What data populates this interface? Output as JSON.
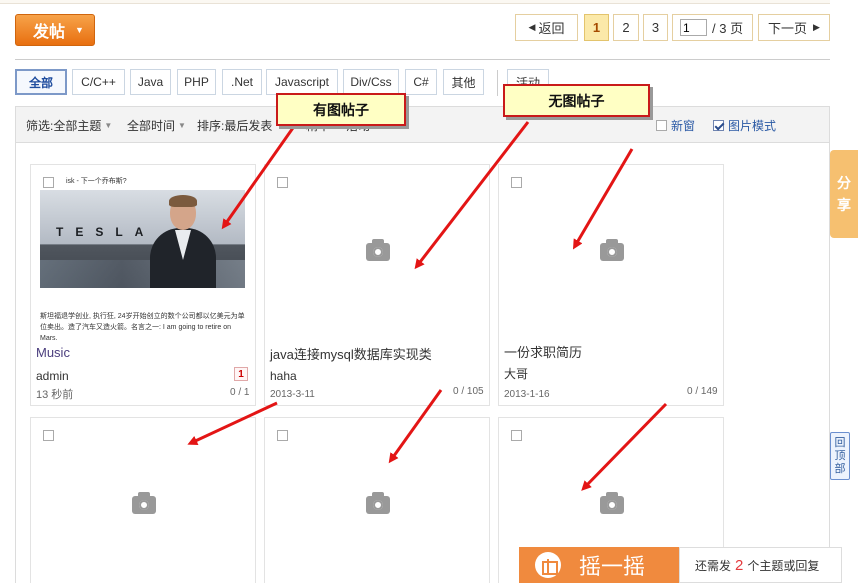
{
  "toolbar": {
    "post_label": "发帖",
    "post_caret": "▼"
  },
  "pager": {
    "back_label": "返回",
    "back_arrow": "◀",
    "pages": [
      "1",
      "2",
      "3"
    ],
    "current": "1",
    "input_value": "1",
    "total_label": "/ 3 页",
    "next_label": "下一页",
    "next_arrow": "▶"
  },
  "tabs": [
    {
      "label": "全部",
      "active": true
    },
    {
      "label": "C/C++"
    },
    {
      "label": "Java"
    },
    {
      "label": "PHP"
    },
    {
      "label": ".Net"
    },
    {
      "label": "Javascript"
    },
    {
      "label": "Div/Css"
    },
    {
      "label": "C#"
    },
    {
      "label": "其他"
    },
    {
      "label": "活动"
    }
  ],
  "filters": {
    "filter_label": "筛选:",
    "topic": "全部主题",
    "time": "全部时间",
    "sort_label": "排序:",
    "sort": "最后发表",
    "hidden_1": "精华",
    "hidden_2": "活动",
    "new_window": "新窗",
    "image_mode": "图片模式"
  },
  "callouts": {
    "with_image": "有图帖子",
    "without_image": "无图帖子"
  },
  "cards": [
    {
      "title": "Music",
      "author": "admin",
      "time": "13 秒前",
      "stats": "0 / 1",
      "badge": "1",
      "image_caption": "isk - 下一个乔布斯?",
      "image_word": "TESLA",
      "image_text": "斯坦福退学创业, 执行狂, 24岁开始创立的数个公司都以亿美元为单位卖出。造了汽车又造火箭。名言之一: I am going to retire on Mars."
    },
    {
      "title": "java连接mysql数据库实现类",
      "author": "haha",
      "time": "2013-3-11",
      "stats": "0 / 105"
    },
    {
      "title": "一份求职简历",
      "author": "大哥",
      "time": "2013-1-16",
      "stats": "0 / 149"
    }
  ],
  "side": {
    "share": [
      "分",
      "享"
    ],
    "backtop": [
      "回",
      "顶",
      "部"
    ]
  },
  "bottom": {
    "shake_label": "摇一摇",
    "need_prefix": "还需发",
    "need_count": "2",
    "need_suffix": "个主题或回复"
  }
}
